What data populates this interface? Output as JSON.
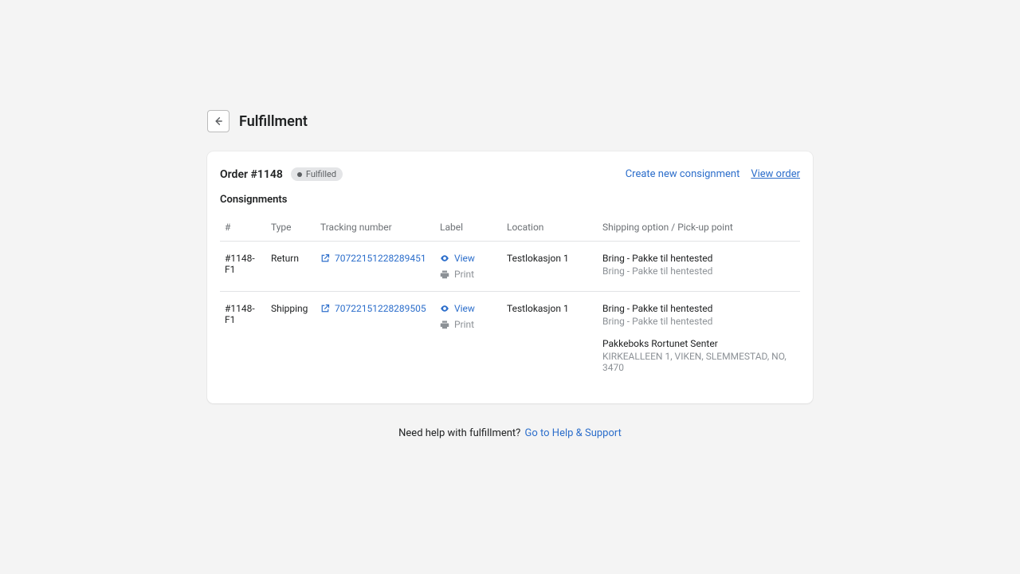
{
  "header": {
    "title": "Fulfillment"
  },
  "card": {
    "order_title": "Order #1148",
    "badge_label": "Fulfilled",
    "create_link": "Create new consignment",
    "view_order_link": "View order",
    "section_heading": "Consignments"
  },
  "table": {
    "columns": {
      "num": "#",
      "type": "Type",
      "tracking": "Tracking number",
      "label": "Label",
      "location": "Location",
      "shipping": "Shipping option / Pick-up point"
    },
    "rows": [
      {
        "id": "#1148-F1",
        "type": "Return",
        "tracking": "70722151228289451",
        "view_label": "View",
        "print_label": "Print",
        "location": "Testlokasjon 1",
        "shipping_main": "Bring - Pakke til hentested",
        "shipping_sub": "Bring - Pakke til hentested"
      },
      {
        "id": "#1148-F1",
        "type": "Shipping",
        "tracking": "70722151228289505",
        "view_label": "View",
        "print_label": "Print",
        "location": "Testlokasjon 1",
        "shipping_main": "Bring - Pakke til hentested",
        "shipping_sub": "Bring - Pakke til hentested",
        "pickup_name": "Pakkeboks Rortunet Senter",
        "pickup_addr": "KIRKEALLEEN 1, VIKEN, SLEMMESTAD, NO, 3470"
      }
    ]
  },
  "help": {
    "text": "Need help with fulfillment?",
    "link": "Go to Help & Support"
  }
}
